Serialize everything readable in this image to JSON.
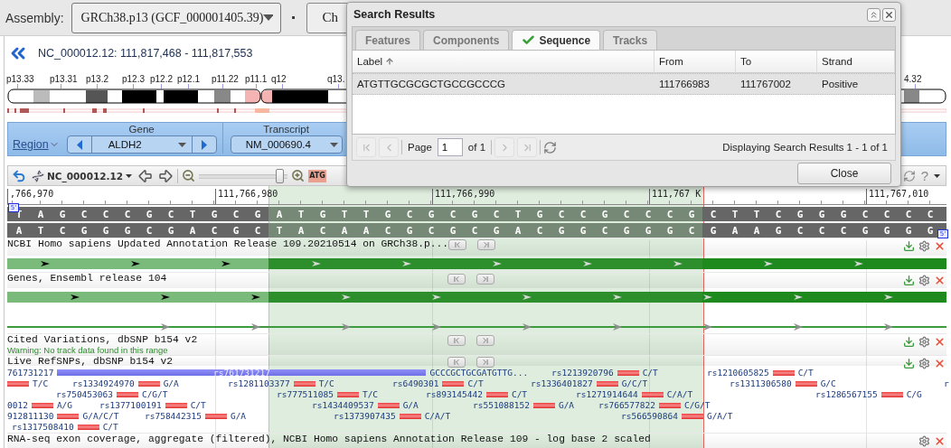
{
  "header": {
    "assembly_label": "Assembly:",
    "assembly_value": "GRCh38.p13 (GCF_000001405.39)",
    "separator": "·",
    "chr_button": "Ch"
  },
  "location": "NC_000012.12: 111,817,468 - 111,817,553",
  "ideogram": {
    "bands": [
      "p13.33",
      "p13.31",
      "p13.2",
      "p12.3",
      "p12.2",
      "p12.1",
      "p11.22",
      "p11.1",
      "q12",
      "q13.",
      "4.32"
    ]
  },
  "region_bar": {
    "region_link": "Region",
    "gene_label": "Gene",
    "gene_value": "ALDH2",
    "transcript_label": "Transcript",
    "transcript_value": "NM_000690.4"
  },
  "viewer_toolbar": {
    "sequence_menu": "NC_000012.12",
    "zoom_slider": {
      "level": 0.95
    },
    "sequence_button": "ATG",
    "help": "?"
  },
  "ruler": [
    ",766,970",
    "111,766,980",
    "111,766,990",
    "111,767 K",
    "111,767,010"
  ],
  "sequence": {
    "five_prime_marks": [
      "5'",
      "5'"
    ],
    "columns": [
      {
        "top": "T",
        "bottom": "A",
        "selected": false
      },
      {
        "top": "A",
        "bottom": "T",
        "selected": false
      },
      {
        "top": "G",
        "bottom": "C",
        "selected": false
      },
      {
        "top": "C",
        "bottom": "G",
        "selected": false
      },
      {
        "top": "C",
        "bottom": "G",
        "selected": false
      },
      {
        "top": "C",
        "bottom": "G",
        "selected": false
      },
      {
        "top": "G",
        "bottom": "C",
        "selected": false
      },
      {
        "top": "C",
        "bottom": "G",
        "selected": false
      },
      {
        "top": "T",
        "bottom": "A",
        "selected": false
      },
      {
        "top": "G",
        "bottom": "C",
        "selected": false
      },
      {
        "top": "C",
        "bottom": "G",
        "selected": false
      },
      {
        "top": "G",
        "bottom": "C",
        "selected": false
      },
      {
        "top": "A",
        "bottom": "T",
        "selected": true
      },
      {
        "top": "T",
        "bottom": "A",
        "selected": true
      },
      {
        "top": "G",
        "bottom": "C",
        "selected": true
      },
      {
        "top": "T",
        "bottom": "A",
        "selected": true
      },
      {
        "top": "T",
        "bottom": "A",
        "selected": true
      },
      {
        "top": "G",
        "bottom": "C",
        "selected": true
      },
      {
        "top": "C",
        "bottom": "G",
        "selected": true
      },
      {
        "top": "G",
        "bottom": "C",
        "selected": true
      },
      {
        "top": "C",
        "bottom": "G",
        "selected": true
      },
      {
        "top": "G",
        "bottom": "C",
        "selected": true
      },
      {
        "top": "C",
        "bottom": "G",
        "selected": true
      },
      {
        "top": "T",
        "bottom": "A",
        "selected": true
      },
      {
        "top": "G",
        "bottom": "C",
        "selected": true
      },
      {
        "top": "C",
        "bottom": "G",
        "selected": true
      },
      {
        "top": "C",
        "bottom": "G",
        "selected": true
      },
      {
        "top": "G",
        "bottom": "C",
        "selected": true
      },
      {
        "top": "C",
        "bottom": "G",
        "selected": true
      },
      {
        "top": "C",
        "bottom": "G",
        "selected": true
      },
      {
        "top": "C",
        "bottom": "G",
        "selected": true
      },
      {
        "top": "G",
        "bottom": "C",
        "selected": true
      },
      {
        "top": "C",
        "bottom": "G",
        "selected": false
      },
      {
        "top": "T",
        "bottom": "A",
        "selected": false
      },
      {
        "top": "T",
        "bottom": "A",
        "selected": false
      },
      {
        "top": "C",
        "bottom": "G",
        "selected": false
      },
      {
        "top": "G",
        "bottom": "C",
        "selected": false
      },
      {
        "top": "G",
        "bottom": "C",
        "selected": false
      },
      {
        "top": "G",
        "bottom": "C",
        "selected": false
      },
      {
        "top": "C",
        "bottom": "G",
        "selected": false
      },
      {
        "top": "C",
        "bottom": "G",
        "selected": false
      },
      {
        "top": "C",
        "bottom": "G",
        "selected": false
      },
      {
        "top": "C",
        "bottom": "G",
        "selected": false
      }
    ]
  },
  "tracks": [
    {
      "kind": "feature",
      "title": "NCBI Homo sapiens Updated Annotation Release 109.20210514 on GRCh38.p...",
      "navigation": true,
      "downloadable": true,
      "rows": [
        {
          "kind": "thick"
        }
      ]
    },
    {
      "kind": "feature",
      "title": "Genes, Ensembl release 104",
      "navigation": true,
      "downloadable": true,
      "rows": [
        {
          "kind": "thick"
        },
        {
          "kind": "thin"
        }
      ]
    },
    {
      "kind": "empty",
      "title": "Cited Variations, dbSNP b154 v2",
      "warning": "Warning: No track data found in this range",
      "navigation": true,
      "downloadable": true
    },
    {
      "kind": "snp",
      "title": "Live RefSNPs, dbSNP b154 v2",
      "navigation": true,
      "downloadable": true,
      "snps": [
        {
          "kind": "span",
          "label": "761731217",
          "inner_label": "rs761731217",
          "alleles": "GCCCGCTGCGATGTTG..."
        },
        {
          "kind": "point",
          "label": "rs1213920796",
          "alleles": "C/T"
        },
        {
          "kind": "point",
          "label": "rs1210605825",
          "alleles": "C/T"
        },
        {
          "kind": "point",
          "alleles": "T/C"
        },
        {
          "kind": "point",
          "label": "rs1334924970",
          "alleles": "G/A"
        },
        {
          "kind": "point",
          "label": "rs1281103377",
          "alleles": "T/C"
        },
        {
          "kind": "point",
          "label": "rs6490301",
          "alleles": "C/T"
        },
        {
          "kind": "point",
          "label": "rs1336401827",
          "alleles": "G/C/T"
        },
        {
          "kind": "point",
          "label": "rs1311306580",
          "alleles": "G/C"
        },
        {
          "kind": "label",
          "label": "r"
        },
        {
          "kind": "point",
          "label": "rs750453063",
          "alleles": "C/G/T"
        },
        {
          "kind": "point",
          "label": "rs777511085",
          "alleles": "T/C"
        },
        {
          "kind": "point",
          "label": "rs893145442",
          "alleles": "C/T"
        },
        {
          "kind": "point",
          "label": "rs1271914644",
          "alleles": "C/A/T"
        },
        {
          "kind": "point",
          "label": "rs1286567155",
          "alleles": "C/G"
        },
        {
          "kind": "point",
          "label": "0012",
          "alleles": "A/G"
        },
        {
          "kind": "point",
          "label": "rs1377100191",
          "alleles": "C/T"
        },
        {
          "kind": "point",
          "label": "rs1434409537",
          "alleles": "G/A"
        },
        {
          "kind": "point",
          "label": "rs551088152",
          "alleles": "G/A"
        },
        {
          "kind": "point",
          "label": "rs766577822",
          "alleles": "C/G/T"
        },
        {
          "kind": "point",
          "label": "912811130",
          "alleles": "G/A/C/T"
        },
        {
          "kind": "point",
          "label": "rs758442315",
          "alleles": "G/A"
        },
        {
          "kind": "point",
          "label": "rs1373907435",
          "alleles": "C/A/T"
        },
        {
          "kind": "point",
          "label": "rs566590864",
          "alleles": "G/A/T"
        },
        {
          "kind": "point",
          "label": "rs1317508410",
          "alleles": "C/T"
        }
      ]
    },
    {
      "kind": "coverage",
      "title": "RNA-seq exon coverage, aggregate (filtered), NCBI Homo sapiens Annotation Release 109 - log base 2 scaled",
      "navigation": false,
      "downloadable": false
    }
  ],
  "dialog": {
    "title": "Search Results",
    "tabs": [
      {
        "label": "Features",
        "selected": false
      },
      {
        "label": "Components",
        "selected": false
      },
      {
        "label": "Sequence",
        "selected": true
      },
      {
        "label": "Tracks",
        "selected": false
      }
    ],
    "grid": {
      "columns": [
        {
          "label": "Label",
          "sorted": true
        },
        {
          "label": "From",
          "sorted": false
        },
        {
          "label": "To",
          "sorted": false
        },
        {
          "label": "Strand",
          "sorted": false
        }
      ],
      "rows": [
        {
          "cells": [
            "ATGTTGCGCGCTGCCGCCCG",
            "111766983",
            "111767002",
            "Positive"
          ],
          "selected": true
        }
      ]
    },
    "pager": {
      "nav_before": [
        {
          "kind": "first",
          "disabled": true
        },
        {
          "kind": "prev",
          "disabled": true
        }
      ],
      "page_label": "Page",
      "page_value": "1",
      "page_total": "of 1",
      "nav_after": [
        {
          "kind": "next",
          "disabled": true
        },
        {
          "kind": "last",
          "disabled": true
        }
      ],
      "status": "Displaying Search Results 1 - 1 of 1"
    },
    "close_button": "Close"
  }
}
